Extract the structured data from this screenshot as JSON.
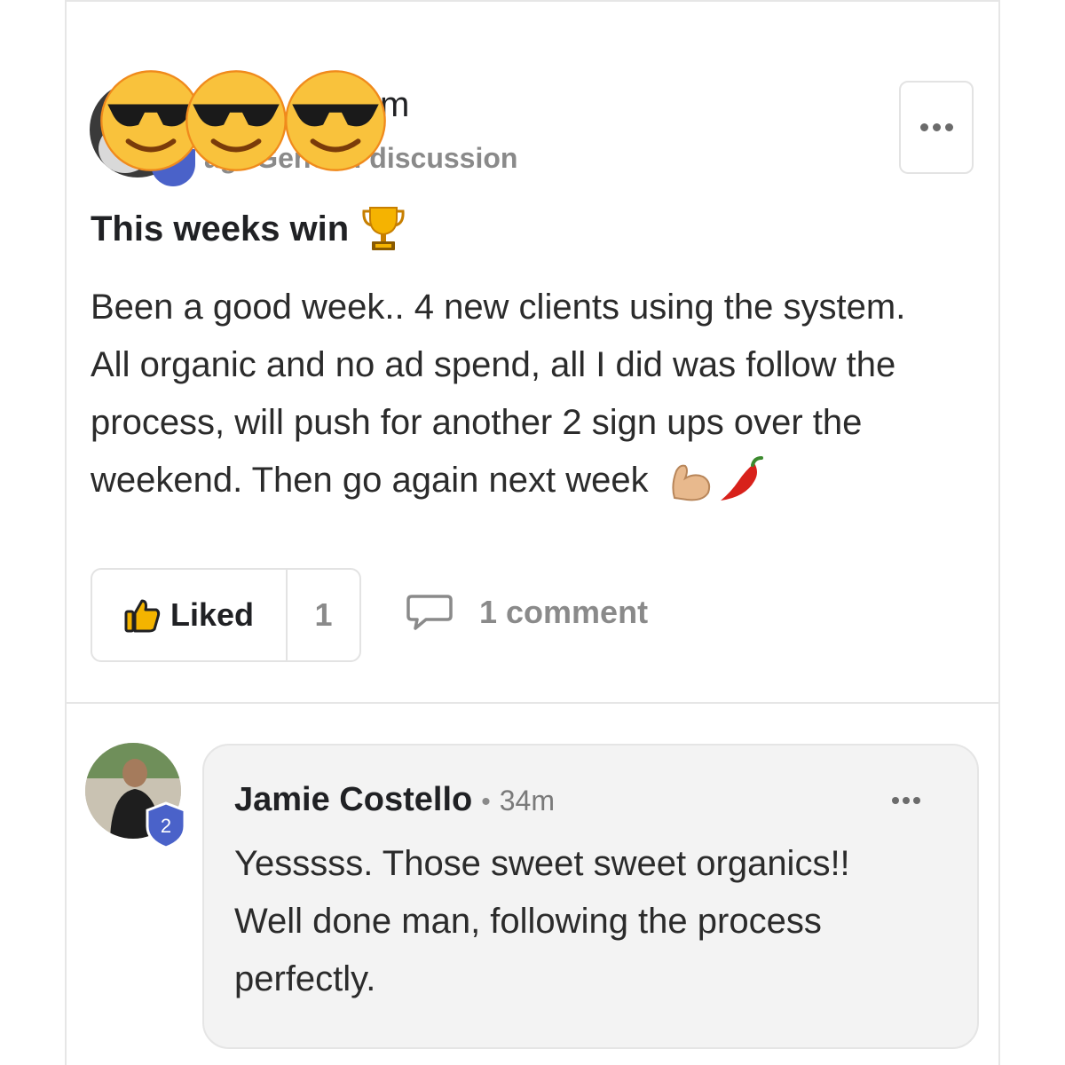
{
  "post": {
    "author_name_visible": "m",
    "meta": {
      "time_visible": "ag",
      "category": "General discussion"
    },
    "title": "This weeks win",
    "title_emoji": "trophy",
    "body_lines": [
      "Been a good week.. 4 new clients using the system.",
      "All organic and no ad spend, all I did was follow the",
      "process, will push for another 2 sign ups over the",
      "weekend. Then go again next week"
    ],
    "body_emojis": [
      "flexed-biceps",
      "hot-pepper"
    ],
    "obscuring_emoji": "smiling-face-with-sunglasses",
    "actions": {
      "like_label": "Liked",
      "like_count": "1",
      "comment_label": "1 comment"
    }
  },
  "comment": {
    "author": "Jamie Costello",
    "separator": "•",
    "time": "34m",
    "level": "2",
    "body_lines": [
      "Yesssss. Those sweet sweet organics!!",
      "Well done man, following the process",
      "perfectly."
    ]
  },
  "colors": {
    "text": "#202124",
    "muted": "#8a8a8a",
    "border": "#e3e3e3",
    "badge_blue": "#4a62c9",
    "bubble_bg": "#f3f3f3"
  }
}
